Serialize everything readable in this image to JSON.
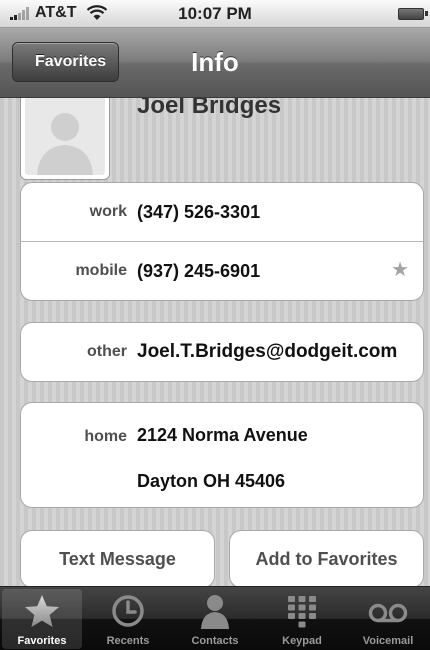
{
  "status": {
    "carrier": "AT&T",
    "time": "10:07 PM"
  },
  "nav": {
    "back_label": "Favorites",
    "title": "Info"
  },
  "contact": {
    "name": "Joel Bridges",
    "phones": [
      {
        "label": "work",
        "value": "(347) 526-3301",
        "favorite": false
      },
      {
        "label": "mobile",
        "value": "(937) 245-6901",
        "favorite": true
      }
    ],
    "email": {
      "label": "other",
      "value": "Joel.T.Bridges@dodgeit.com"
    },
    "address": {
      "label": "home",
      "line1": "2124 Norma Avenue",
      "line2": "Dayton OH 45406"
    }
  },
  "actions": {
    "text_message": "Text Message",
    "add_favorites": "Add to Favorites"
  },
  "tabs": [
    {
      "label": "Favorites",
      "icon": "star-icon",
      "active": true
    },
    {
      "label": "Recents",
      "icon": "clock-icon",
      "active": false
    },
    {
      "label": "Contacts",
      "icon": "person-icon",
      "active": false
    },
    {
      "label": "Keypad",
      "icon": "keypad-icon",
      "active": false
    },
    {
      "label": "Voicemail",
      "icon": "voicemail-icon",
      "active": false
    }
  ],
  "colors": {
    "tab_active": "#ffffff",
    "tab_inactive": "#9a9a9a",
    "favorite_star": "#a3a3a3"
  }
}
